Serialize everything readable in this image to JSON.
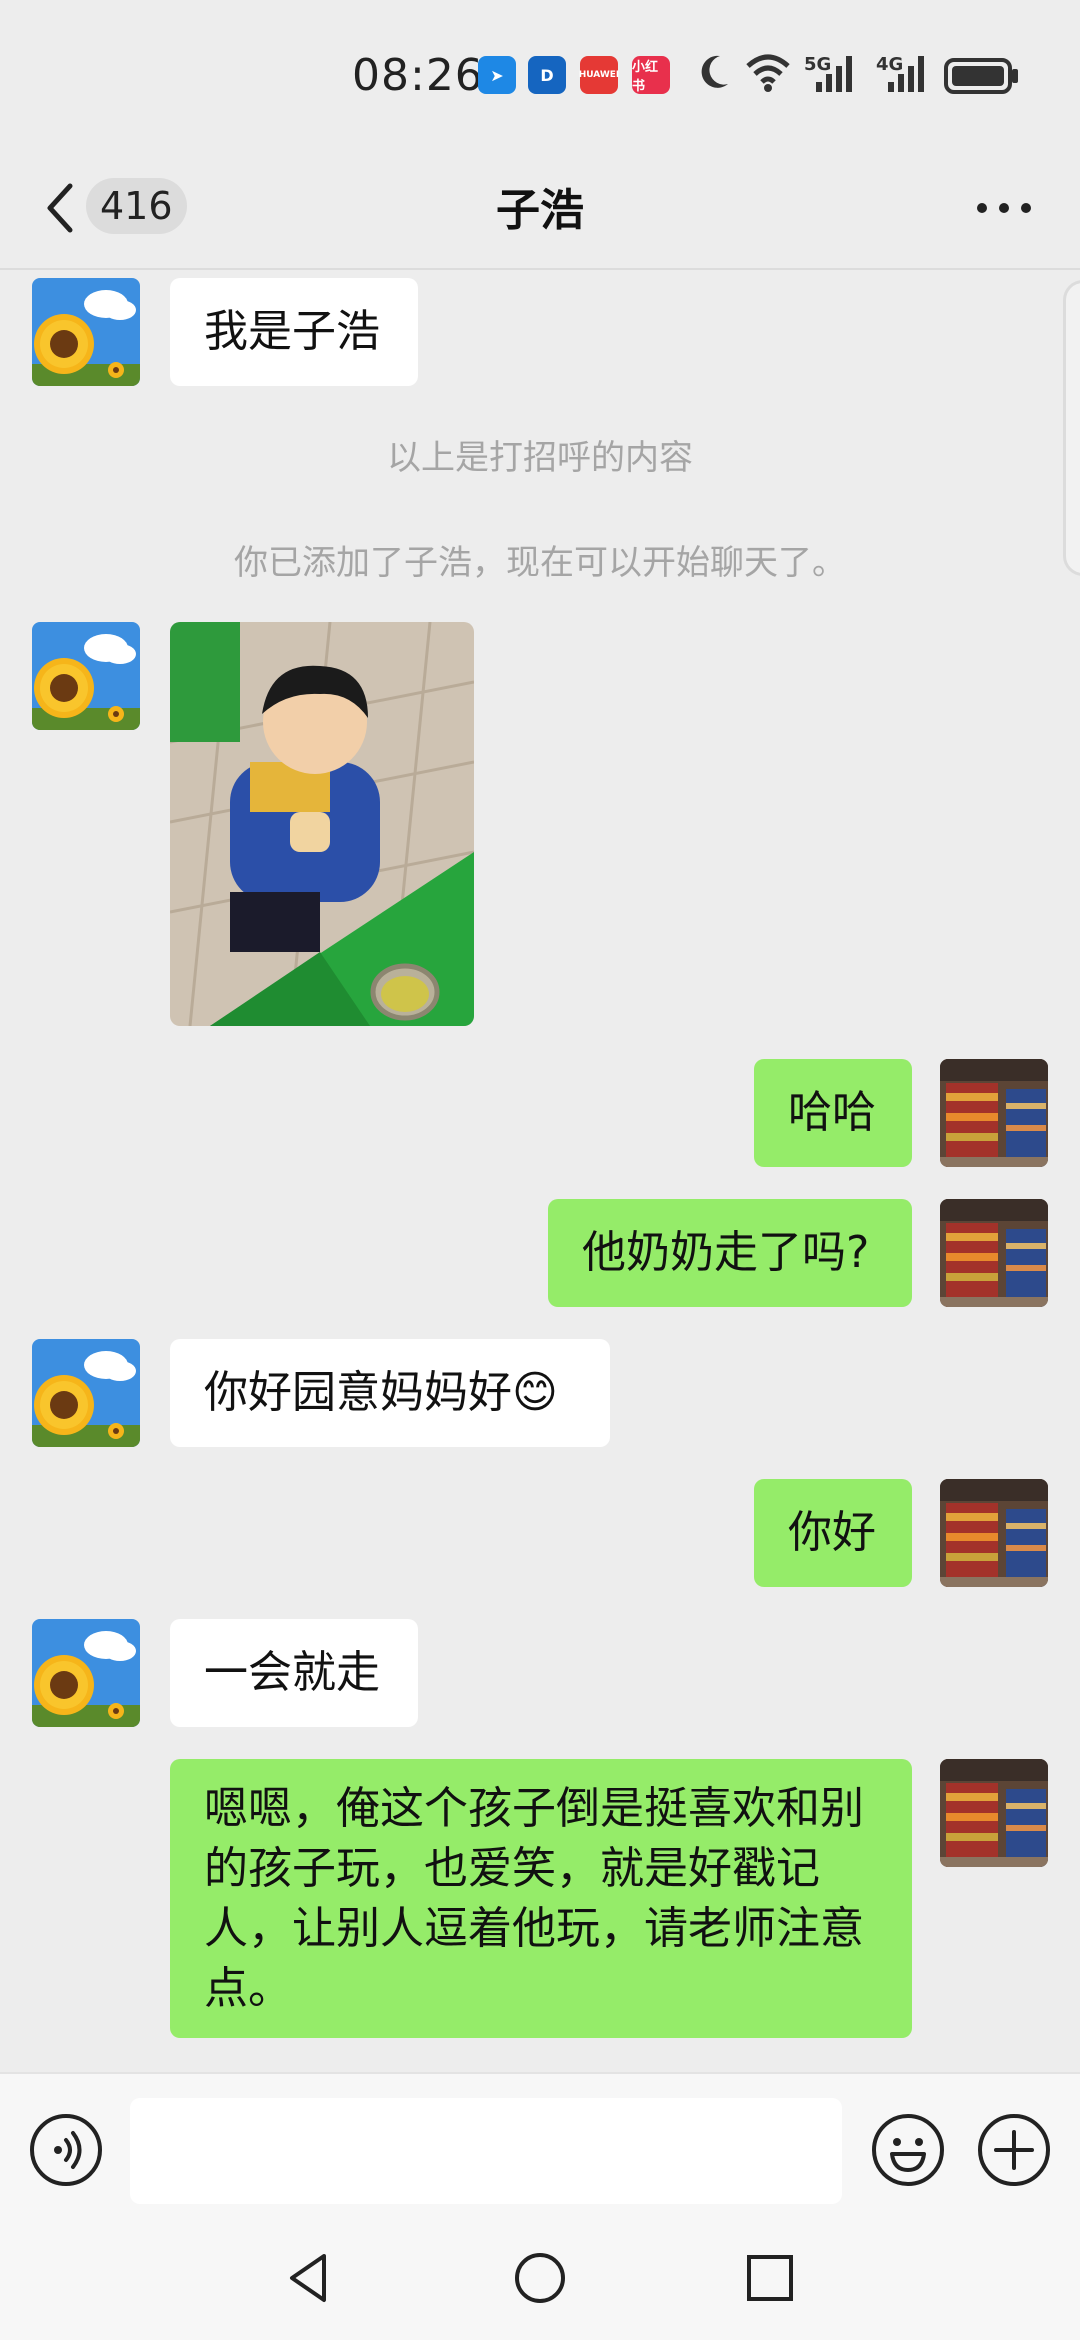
{
  "status": {
    "time": "08:26",
    "apps": [
      {
        "name": "app-blue-arrow",
        "color": "#1e88e5",
        "glyph": "➤"
      },
      {
        "name": "app-d",
        "color": "#1565c0",
        "glyph": "D"
      },
      {
        "name": "app-huawei",
        "color": "#e53935",
        "glyph": "HUAWEI"
      },
      {
        "name": "app-xiaohongshu",
        "color": "#e8304c",
        "glyph": "小红书"
      }
    ],
    "signal1": "5G",
    "signal2": "4G"
  },
  "header": {
    "unread_count": "416",
    "contact_name": "子浩"
  },
  "messages": [
    {
      "side": "in",
      "text": "我是子浩"
    },
    {
      "system": "以上是打招呼的内容"
    },
    {
      "system": "你已添加了子浩，现在可以开始聊天了。"
    },
    {
      "side": "in",
      "image": "photo-child-eating"
    },
    {
      "side": "out",
      "text": "哈哈"
    },
    {
      "side": "out",
      "text": "他奶奶走了吗?"
    },
    {
      "side": "in",
      "text": "你好园意妈妈好😊"
    },
    {
      "side": "out",
      "text": "你好"
    },
    {
      "side": "in",
      "text": "一会就走"
    },
    {
      "side": "out",
      "text": "嗯嗯，俺这个孩子倒是挺喜欢和别的孩子玩，也爱笑，就是好戳记人，让别人逗着他玩，请老师注意点。"
    }
  ],
  "icons": {
    "voice": "voice-icon",
    "emoji": "emoji-icon",
    "plus": "plus-icon",
    "back": "back-icon",
    "more": "more-icon"
  },
  "colors": {
    "out_bubble": "#95ec69",
    "in_bubble": "#ffffff",
    "background": "#ededed"
  }
}
